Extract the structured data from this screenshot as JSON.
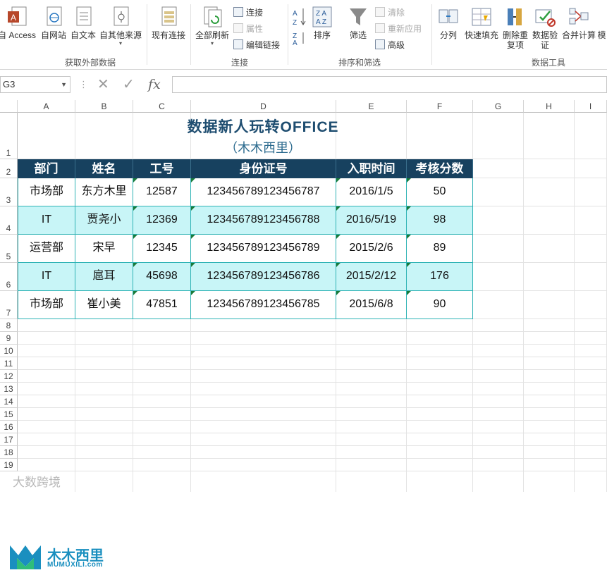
{
  "ribbon": {
    "external_data": {
      "group_label": "获取外部数据",
      "buttons": [
        "自 Access",
        "自网站",
        "自文本",
        "自其他来源",
        "现有连接"
      ]
    },
    "connections": {
      "group_label": "连接",
      "refresh_all": "全部刷新",
      "small": [
        "连接",
        "属性",
        "编辑链接"
      ]
    },
    "sort_filter": {
      "group_label": "排序和筛选",
      "sort": "排序",
      "filter": "筛选",
      "small": [
        "清除",
        "重新应用",
        "高级"
      ]
    },
    "data_tools": {
      "group_label": "数据工具",
      "buttons": [
        "分列",
        "快速填充",
        "删除重复项",
        "数据验证",
        "合并计算",
        "模"
      ]
    }
  },
  "formula_bar": {
    "name_box": "G3",
    "value": ""
  },
  "sheet": {
    "columns": [
      "A",
      "B",
      "C",
      "D",
      "E",
      "F",
      "G",
      "H",
      "I"
    ],
    "rows": [
      "1",
      "2",
      "3",
      "4",
      "5",
      "6",
      "7",
      "8",
      "9",
      "10",
      "11",
      "12",
      "13",
      "14",
      "15",
      "16",
      "17",
      "18",
      "19"
    ],
    "title": "数据新人玩转OFFICE",
    "subtitle": "（木木西里）",
    "headers": [
      "部门",
      "姓名",
      "工号",
      "身份证号",
      "入职时间",
      "考核分数"
    ],
    "data": [
      [
        "市场部",
        "东方木里",
        "12587",
        "123456789123456787",
        "2016/1/5",
        "50"
      ],
      [
        "IT",
        "贾尧小",
        "12369",
        "123456789123456788",
        "2016/5/19",
        "98"
      ],
      [
        "运营部",
        "宋早",
        "12345",
        "123456789123456789",
        "2015/2/6",
        "89"
      ],
      [
        "IT",
        "扈耳",
        "45698",
        "123456789123456786",
        "2015/2/12",
        "176"
      ],
      [
        "市场部",
        "崔小美",
        "47851",
        "123456789123456785",
        "2015/6/8",
        "90"
      ]
    ]
  },
  "logo": {
    "name": "木木西里",
    "url": "MUMUXILI.com"
  },
  "watermark": "大数跨境",
  "colors": {
    "header_bg": "#17415f",
    "alt_row": "#c8f5f7",
    "border": "#2fb3b5",
    "title": "#1e4d70"
  }
}
